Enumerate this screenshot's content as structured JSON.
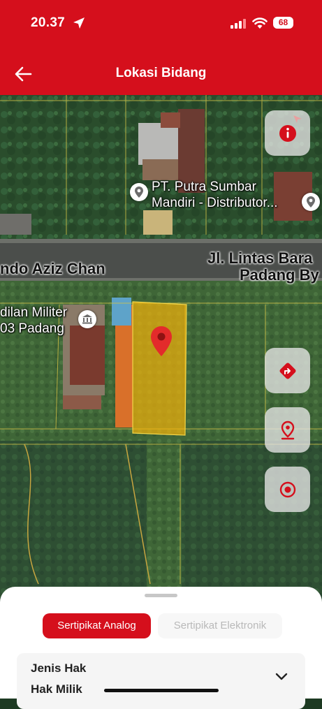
{
  "status_bar": {
    "time": "20.37",
    "battery": "68"
  },
  "header": {
    "title": "Lokasi Bidang"
  },
  "map": {
    "poi_1": {
      "line1": "PT. Putra Sumbar",
      "line2": "Mandiri - Distributor..."
    },
    "poi_2": {
      "line1": "dilan Militer",
      "line2": "03 Padang"
    },
    "road_1": "ndo Aziz Chan",
    "road_2": {
      "line1": "Jl. Lintas Bara",
      "line2": "Padang By"
    },
    "parcel_color": "#f3b20a",
    "marker_color": "#e32b2b"
  },
  "map_controls": {
    "top": "info-icon",
    "buttons": [
      "directions-icon",
      "location-pin-icon",
      "target-icon"
    ]
  },
  "bottom_sheet": {
    "tabs": [
      {
        "label": "Sertipikat Analog",
        "active": true
      },
      {
        "label": "Sertipikat Elektronik",
        "active": false
      }
    ],
    "field": {
      "label": "Jenis Hak",
      "value": "Hak Milik"
    }
  },
  "colors": {
    "brand_red": "#d50f1c"
  }
}
